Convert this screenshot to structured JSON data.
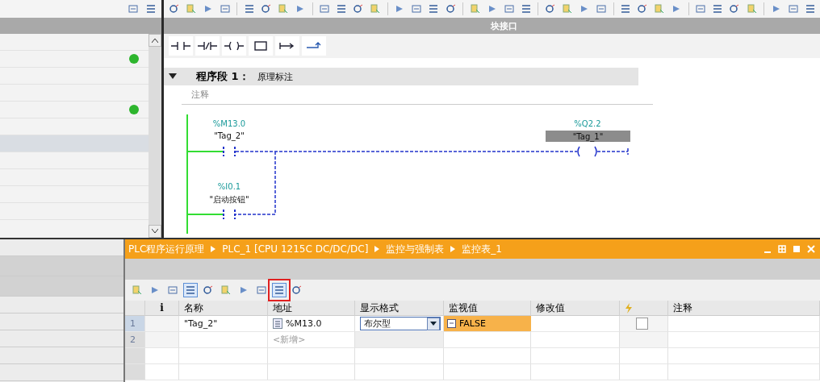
{
  "left_panel": {
    "rows": [
      {
        "selected": false
      },
      {
        "selected": false,
        "color": "#2db52d"
      },
      {
        "selected": false
      },
      {
        "selected": false
      },
      {
        "selected": false,
        "color": "#2db52d"
      },
      {
        "selected": false
      },
      {
        "selected": true
      },
      {
        "selected": false
      },
      {
        "selected": false
      },
      {
        "selected": false
      },
      {
        "selected": false
      }
    ]
  },
  "block_interface": {
    "label": "块接口"
  },
  "network": {
    "expanded": true,
    "title": "程序段 1：",
    "subtitle": "原理标注",
    "comment": "注释"
  },
  "ladder": {
    "contacts": [
      {
        "address": "%M13.0",
        "tag": "\"Tag_2\""
      },
      {
        "address": "%I0.1",
        "tag": "\"启动按钮\""
      }
    ],
    "coil": {
      "address": "%Q2.2",
      "tag": "\"Tag_1\""
    }
  },
  "watch_table": {
    "breadcrumb": [
      "PLC程序运行原理",
      "PLC_1 [CPU 1215C DC/DC/DC]",
      "监控与强制表",
      "监控表_1"
    ],
    "tools": [
      {
        "pressed": false,
        "highlighted": false
      },
      {
        "pressed": false,
        "highlighted": false
      },
      {
        "pressed": false,
        "highlighted": false
      },
      {
        "pressed": true,
        "highlighted": false
      },
      {
        "pressed": false,
        "highlighted": false
      },
      {
        "pressed": false,
        "highlighted": false
      },
      {
        "pressed": false,
        "highlighted": false
      },
      {
        "pressed": false,
        "highlighted": false
      },
      {
        "pressed": true,
        "highlighted": true
      },
      {
        "pressed": false,
        "highlighted": false
      }
    ],
    "columns": [
      {
        "kind": "text",
        "label": "i"
      },
      {
        "kind": "text",
        "label": "名称"
      },
      {
        "kind": "text",
        "label": "地址"
      },
      {
        "kind": "text",
        "label": "显示格式"
      },
      {
        "kind": "text",
        "label": "监视值"
      },
      {
        "kind": "text",
        "label": "修改值"
      },
      {
        "kind": "icon"
      },
      {
        "kind": "text",
        "label": "注释"
      }
    ],
    "rows": [
      {
        "kind": "tag",
        "number": "1",
        "selected": true,
        "name": "\"Tag_2\"",
        "address": "%M13.0",
        "format": "布尔型",
        "monitor": "FALSE",
        "checked": false
      },
      {
        "kind": "new",
        "number": "2",
        "selected": false,
        "address": "<新增>"
      }
    ]
  }
}
